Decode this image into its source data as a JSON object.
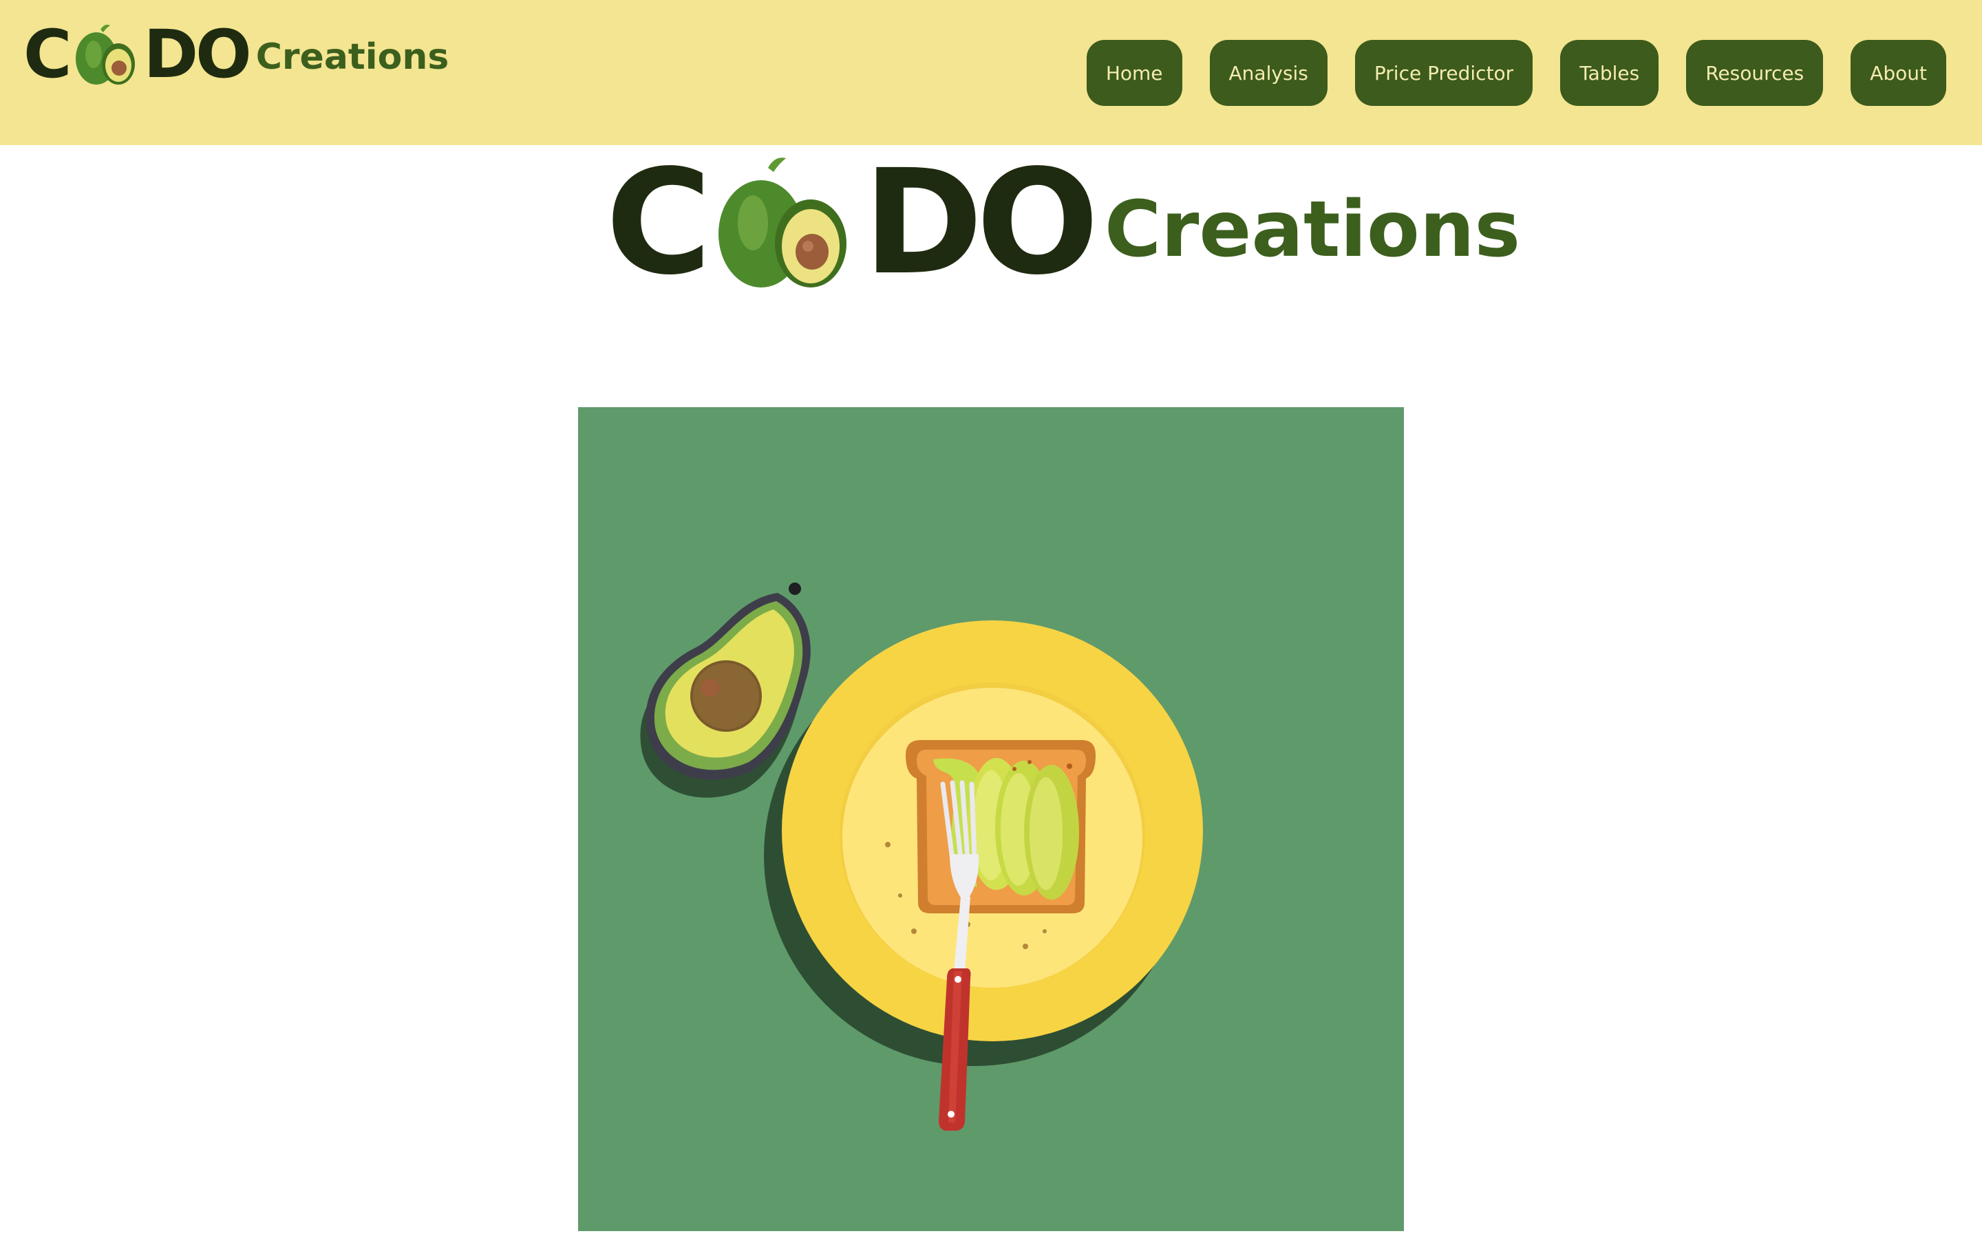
{
  "header": {
    "logo": {
      "letter_c": "C",
      "letters_do": "DO",
      "tagline": "Creations"
    },
    "nav": [
      {
        "label": "Home"
      },
      {
        "label": "Analysis"
      },
      {
        "label": "Price Predictor"
      },
      {
        "label": "Tables"
      },
      {
        "label": "Resources"
      },
      {
        "label": "About"
      }
    ]
  },
  "hero": {
    "logo": {
      "letter_c": "C",
      "letters_do": "DO",
      "tagline": "Creations"
    },
    "illustration": {
      "subject": "avocado-toast-plate-illustration",
      "icons": [
        "avocado-half-icon",
        "plate-icon",
        "toast-icon",
        "fork-icon"
      ]
    }
  },
  "colors": {
    "header_bg": "#f3e591",
    "nav_button_bg": "#3c5b1c",
    "nav_button_text": "#f5ecb0",
    "logo_dark": "#1f2b10",
    "logo_green": "#3c5f1d",
    "art_bg": "#5f9a6b",
    "plate": "#f7d444"
  }
}
